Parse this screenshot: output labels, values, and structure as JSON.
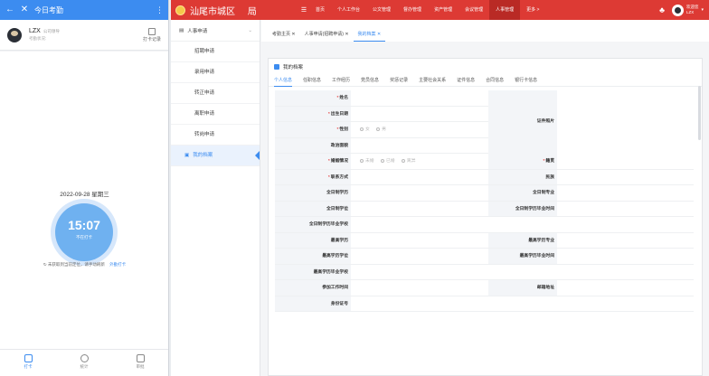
{
  "phone": {
    "header": {
      "title": "今日考勤"
    },
    "user": {
      "name": "LZX",
      "role": "公司领导",
      "status": "考勤状况:",
      "records_label": "打卡记录"
    },
    "date": "2022-09-28 星期三",
    "clock": {
      "time": "15:07",
      "status": "不在打卡"
    },
    "location": {
      "text": "未获取到当前定位，请手动刷新",
      "refresh": "外勤打卡"
    },
    "tabs": [
      {
        "label": "打卡"
      },
      {
        "label": "统计"
      },
      {
        "label": "审批"
      }
    ]
  },
  "topbar": {
    "system_name": "汕尾市城区",
    "system_suffix": "局",
    "nav": [
      "首页",
      "个人工作台",
      "公文管理",
      "督办管理",
      "资产管理",
      "会议管理",
      "人事管理",
      "更多 >"
    ],
    "active_nav": "人事管理",
    "user_greeting": "欢迎您",
    "user_name": "LZX",
    "brand_color": "#dd3a34"
  },
  "sidebar": {
    "group": "人事申请",
    "items": [
      "招聘申请",
      "录用申请",
      "转正申请",
      "离职申请",
      "转岗申请"
    ],
    "active_item": "我的档案"
  },
  "tabs": [
    "考勤主页",
    "人事申请(招聘申请)",
    "我的档案"
  ],
  "panel": {
    "title": "我的档案",
    "subtabs": [
      "个人信息",
      "任职信息",
      "工作经历",
      "党员信息",
      "奖惩记录",
      "主要社会关系",
      "证件信息",
      "合同信息",
      "银行卡信息"
    ],
    "photo_label": "证件照片",
    "gender_options": [
      "女",
      "男"
    ],
    "marriage_options": [
      "未婚",
      "已婚",
      "离异"
    ],
    "fields": {
      "name": "姓名",
      "birth": "出生日期",
      "gender": "性别",
      "politics": "政治面貌",
      "marriage": "婚姻情况",
      "native": "籍贯",
      "contact": "联系方式",
      "ethnic": "民族",
      "ft_edu": "全日制学历",
      "ft_major": "全日制专业",
      "ft_degree": "全日制学位",
      "ft_grad_time": "全日制学历毕业时间",
      "ft_school": "全日制学历毕业学校",
      "top_edu": "最高学历",
      "top_major": "最高学历专业",
      "top_degree": "最高学历学位",
      "top_grad_time": "最高学历毕业时间",
      "top_school": "最高学历毕业学校",
      "work_start": "参加工作时间",
      "mail_addr": "邮箱地址",
      "last_row": "身份证号"
    }
  }
}
